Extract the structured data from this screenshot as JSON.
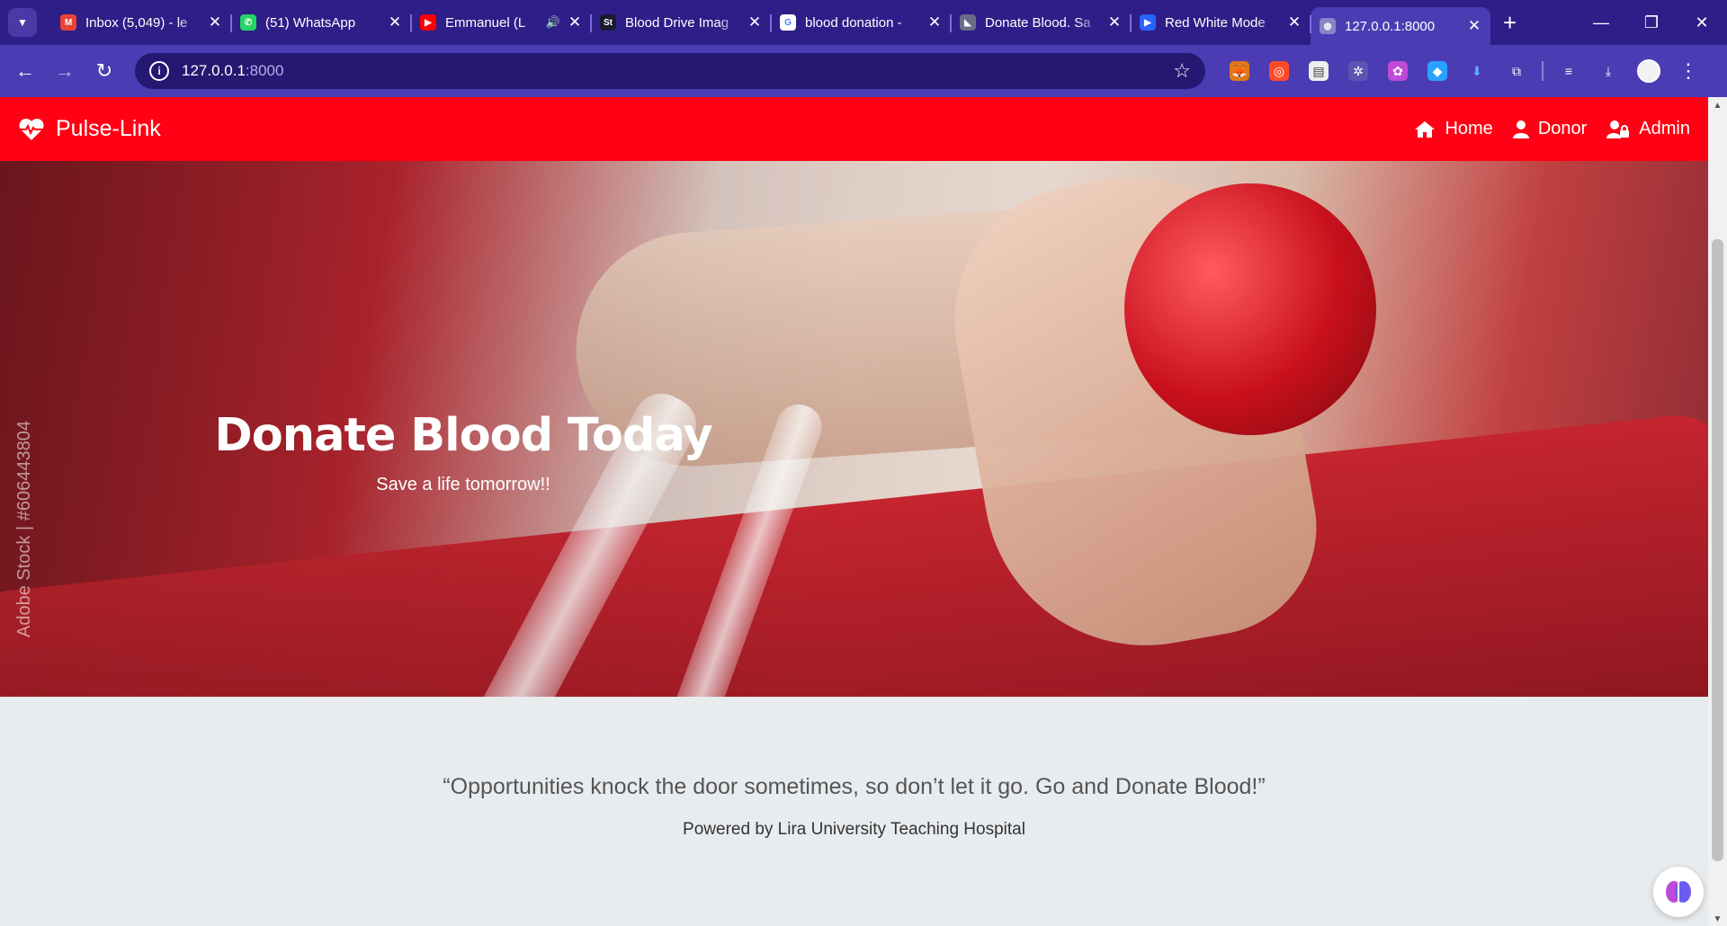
{
  "browser": {
    "tabs": [
      {
        "title": "Inbox (5,049) - le",
        "icon": "gmail-icon",
        "color": "#ea4335",
        "glyph": "M"
      },
      {
        "title": "(51) WhatsApp",
        "icon": "whatsapp-icon",
        "color": "#25d366",
        "glyph": "✆"
      },
      {
        "title": "Emmanuel (L",
        "icon": "youtube-icon",
        "color": "#ff0000",
        "glyph": "▶",
        "audio": "🔊"
      },
      {
        "title": "Blood Drive Imag",
        "icon": "stock-icon",
        "color": "#1a1a2e",
        "glyph": "St"
      },
      {
        "title": "blood donation -",
        "icon": "google-icon",
        "color": "#ffffff",
        "glyph": "G"
      },
      {
        "title": "Donate Blood. Sa",
        "icon": "adobe-icon",
        "color": "#6c6c8a",
        "glyph": "◣"
      },
      {
        "title": "Red White Mode",
        "icon": "video-icon",
        "color": "#2962ff",
        "glyph": "▶"
      },
      {
        "title": "127.0.0.1:8000",
        "icon": "globe-icon",
        "color": "#8a84c4",
        "glyph": "◍",
        "active": true
      }
    ],
    "close_glyph": "✕",
    "new_tab": "+",
    "window_controls": {
      "minimize": "—",
      "restore": "❐",
      "close": "✕"
    },
    "url_host": "127.0.0.1",
    "url_port": ":8000"
  },
  "site": {
    "brand": "Pulse-Link",
    "nav": {
      "home": "Home",
      "donor": "Donor",
      "admin": "Admin"
    }
  },
  "hero": {
    "title": "Donate Blood Today",
    "subtitle": "Save a life tomorrow!!",
    "watermark": "Adobe Stock | #606443804"
  },
  "quote": {
    "text": "“Opportunities knock the door sometimes, so don’t let it go. Go and Donate Blood!”",
    "powered_by": "Powered by Lira University Teaching Hospital"
  },
  "colors": {
    "navbar": "#ff0014",
    "chrome_dark": "#2e1e88",
    "chrome_light": "#4b3cb4"
  }
}
